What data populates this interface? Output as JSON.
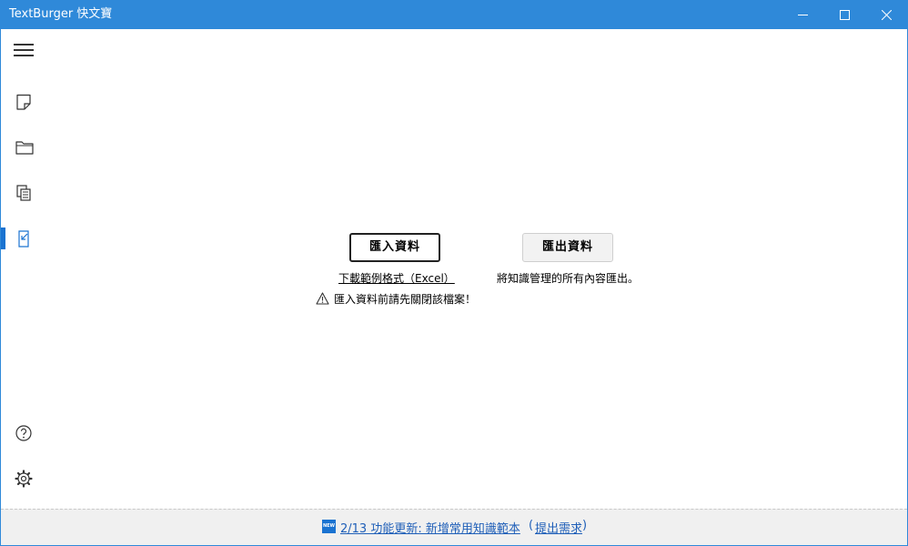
{
  "window": {
    "title": "TextBurger 快文寶"
  },
  "sidebar": {
    "items": [
      {
        "name": "menu",
        "icon": "hamburger-menu-icon"
      },
      {
        "name": "notes",
        "icon": "note-icon"
      },
      {
        "name": "folders",
        "icon": "folder-icon"
      },
      {
        "name": "copy",
        "icon": "copy-documents-icon"
      },
      {
        "name": "import-export",
        "icon": "import-export-icon",
        "active": true
      },
      {
        "name": "help",
        "icon": "help-icon"
      },
      {
        "name": "settings",
        "icon": "gear-icon"
      }
    ]
  },
  "main": {
    "import_button": "匯入資料",
    "export_button": "匯出資料",
    "download_template": "下載範例格式（Excel）",
    "export_description": "將知識管理的所有內容匯出。",
    "warning_text": "匯入資料前請先關閉該檔案！"
  },
  "footer": {
    "badge": "NEW",
    "update_text": "2/13 功能更新: 新增常用知識範本",
    "paren_open": "(",
    "request_text": "提出需求",
    "paren_close": ")"
  },
  "colors": {
    "accent": "#2f89d9",
    "active_indicator": "#1a73d1",
    "link": "#1f5fb8"
  }
}
